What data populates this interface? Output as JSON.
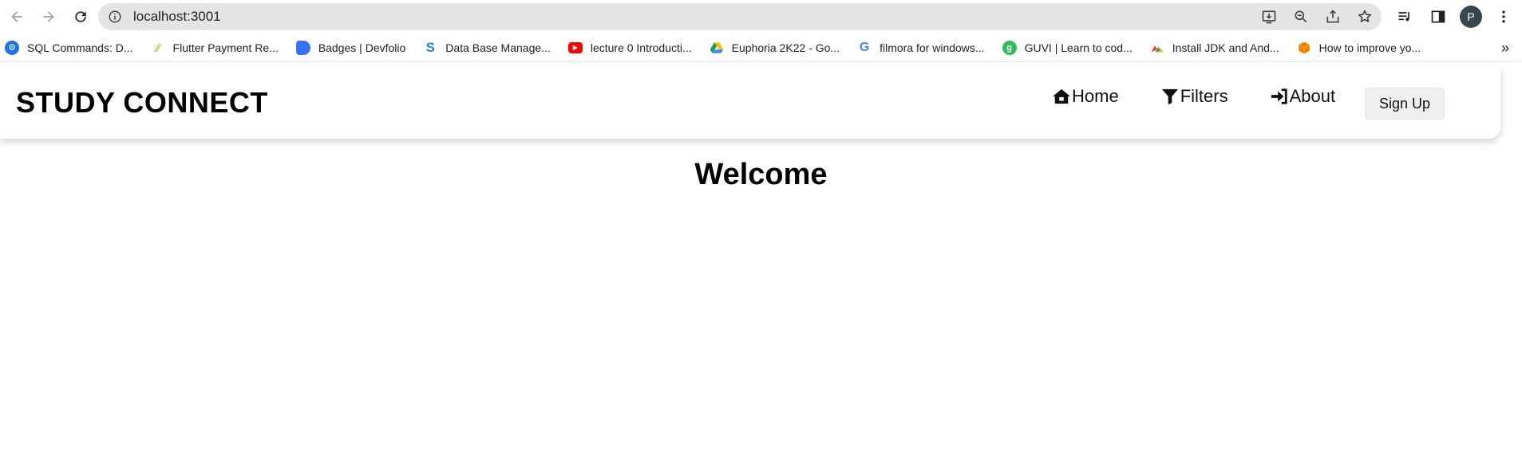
{
  "browser": {
    "url": "localhost:3001",
    "avatar_letter": "P",
    "bookmarks": [
      {
        "label": "SQL Commands: D...",
        "color": "#1a73e8"
      },
      {
        "label": "Flutter Payment Re...",
        "color": "#9acd32"
      },
      {
        "label": "Badges | Devfolio",
        "color": "#3770ff"
      },
      {
        "label": "Data Base Manage...",
        "color": "#1e88e5"
      },
      {
        "label": "lecture 0 Introducti...",
        "color": "#ff0000"
      },
      {
        "label": "Euphoria 2K22 - Go...",
        "color": "#0f9d58"
      },
      {
        "label": "filmora for windows...",
        "color": "#4285f4"
      },
      {
        "label": "GUVI | Learn to cod...",
        "color": "#2ebd59"
      },
      {
        "label": "Install JDK and And...",
        "color": "#ea4335"
      },
      {
        "label": "How to improve yo...",
        "color": "#f57c00"
      }
    ],
    "more_label": "»"
  },
  "app": {
    "brand": "STUDY CONNECT",
    "nav": {
      "home": "Home",
      "filters": "Filters",
      "about": "About",
      "signup": "Sign Up"
    },
    "welcome": "Welcome"
  }
}
